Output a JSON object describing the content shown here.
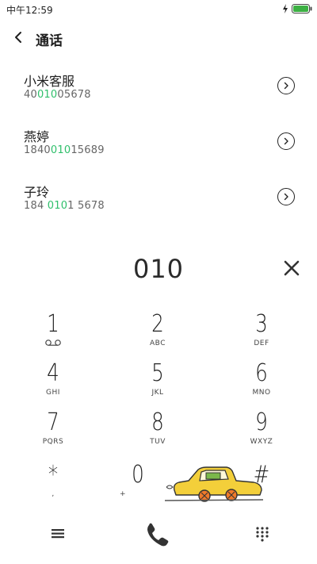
{
  "status": {
    "time": "中午12:59",
    "battery_color": "#3cb043"
  },
  "header": {
    "title": "通话"
  },
  "contacts": [
    {
      "name": "小米客服",
      "number_pre": "40",
      "number_hl": "010",
      "number_post": "05678"
    },
    {
      "name": "燕婷",
      "number_pre": "1840",
      "number_hl": "010",
      "number_post": "15689"
    },
    {
      "name": "子玲",
      "number_pre": "184 ",
      "number_hl": "010",
      "number_post": "1 5678"
    }
  ],
  "dial": {
    "number": "010"
  },
  "keypad": [
    {
      "digit": "1",
      "letters": "voicemail"
    },
    {
      "digit": "2",
      "letters": "ABC"
    },
    {
      "digit": "3",
      "letters": "DEF"
    },
    {
      "digit": "4",
      "letters": "GHI"
    },
    {
      "digit": "5",
      "letters": "JKL"
    },
    {
      "digit": "6",
      "letters": "MNO"
    },
    {
      "digit": "7",
      "letters": "PQRS"
    },
    {
      "digit": "8",
      "letters": "TUV"
    },
    {
      "digit": "9",
      "letters": "WXYZ"
    },
    {
      "digit": "*",
      "letters": ","
    },
    {
      "digit": "0",
      "letters": "+"
    },
    {
      "digit": "#",
      "letters": ""
    }
  ],
  "colors": {
    "highlight": "#2fbf6b",
    "car": "#f3cf3a"
  },
  "icons": {
    "back": "chevron-left-icon",
    "detail": "chevron-right-circle-icon",
    "clear": "close-icon",
    "menu": "menu-icon",
    "call": "phone-icon",
    "dialpad": "dialpad-icon"
  }
}
